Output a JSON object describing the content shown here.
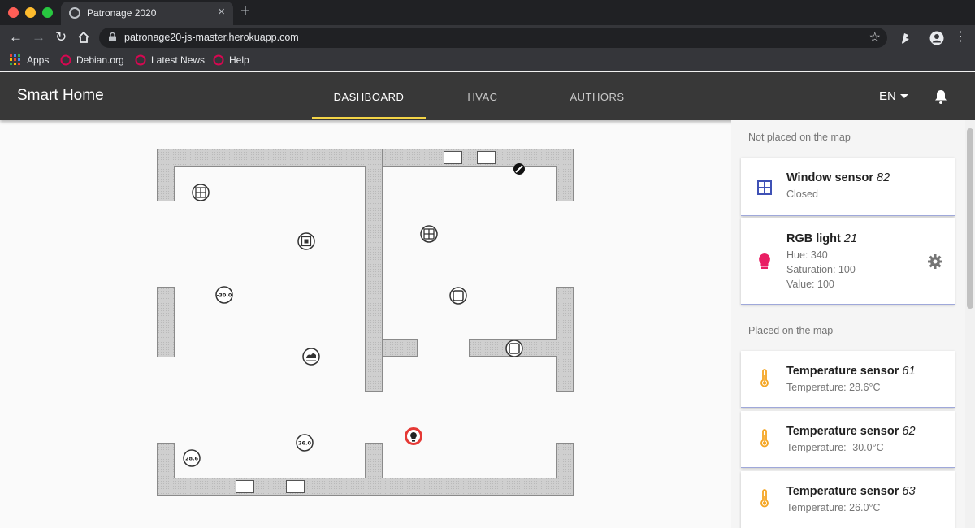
{
  "browser": {
    "tab_title": "Patronage 2020",
    "url": "patronage20-js-master.herokuapp.com",
    "bookmarks": [
      {
        "label": "Apps"
      },
      {
        "label": "Debian.org"
      },
      {
        "label": "Latest News"
      },
      {
        "label": "Help"
      }
    ]
  },
  "app": {
    "brand": "Smart Home",
    "tabs": [
      {
        "label": "DASHBOARD",
        "active": true
      },
      {
        "label": "HVAC",
        "active": false
      },
      {
        "label": "AUTHORS",
        "active": false
      }
    ],
    "language": "EN"
  },
  "map": {
    "temperature_markers": [
      {
        "value": "-30.0"
      },
      {
        "value": "26.0"
      },
      {
        "value": "28.6"
      }
    ]
  },
  "panel": {
    "not_placed_title": "Not placed on the map",
    "placed_title": "Placed on the map",
    "not_placed": [
      {
        "name": "Window sensor",
        "id": "82",
        "lines": [
          "Closed"
        ],
        "icon": "window-icon",
        "color": "#3f51b5"
      },
      {
        "name": "RGB light",
        "id": "21",
        "lines": [
          "Hue: 340",
          "Saturation: 100",
          "Value: 100"
        ],
        "icon": "bulb-icon",
        "color": "#e91e63",
        "has_settings": true
      }
    ],
    "placed": [
      {
        "name": "Temperature sensor",
        "id": "61",
        "lines": [
          "Temperature: 28.6°C"
        ],
        "icon": "thermometer-icon",
        "color": "#f5a623"
      },
      {
        "name": "Temperature sensor",
        "id": "62",
        "lines": [
          "Temperature: -30.0°C"
        ],
        "icon": "thermometer-icon",
        "color": "#f5a623"
      },
      {
        "name": "Temperature sensor",
        "id": "63",
        "lines": [
          "Temperature: 26.0°C"
        ],
        "icon": "thermometer-icon",
        "color": "#f5a623"
      }
    ]
  },
  "colors": {
    "accent": "#f5d547",
    "appbar": "#383838",
    "wall": "#d0d0d0",
    "active_marker": "#e53935"
  }
}
